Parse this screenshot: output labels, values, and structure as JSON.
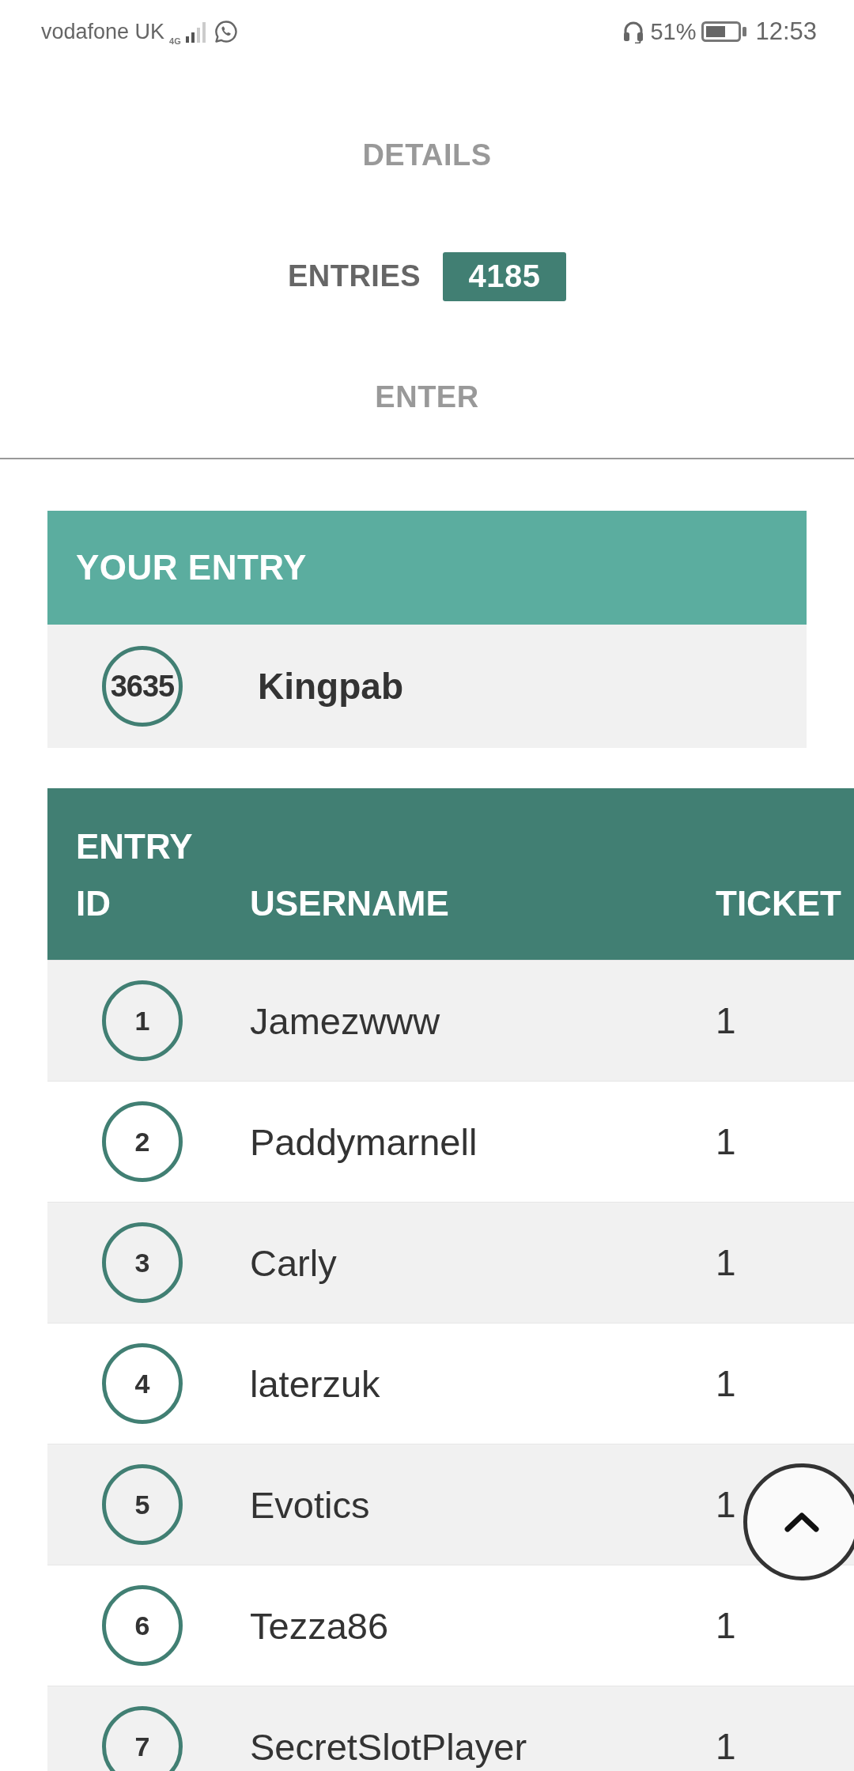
{
  "status_bar": {
    "carrier": "vodafone UK",
    "network": "4G",
    "battery": "51%",
    "time": "12:53"
  },
  "tabs": [
    {
      "label": "DETAILS",
      "selected": false
    },
    {
      "label": "ENTRIES",
      "selected": true,
      "badge": "4185"
    },
    {
      "label": "ENTER",
      "selected": false
    }
  ],
  "your_entry": {
    "title": "YOUR ENTRY",
    "entry_id": "3635",
    "username": "Kingpab"
  },
  "entries_table": {
    "columns": [
      "ENTRY ID",
      "USERNAME",
      "TICKET"
    ],
    "rows": [
      {
        "entry_id": "1",
        "username": "Jamezwww",
        "tickets": "1"
      },
      {
        "entry_id": "2",
        "username": "Paddymarnell",
        "tickets": "1"
      },
      {
        "entry_id": "3",
        "username": "Carly",
        "tickets": "1"
      },
      {
        "entry_id": "4",
        "username": "laterzuk",
        "tickets": "1"
      },
      {
        "entry_id": "5",
        "username": "Evotics",
        "tickets": "1"
      },
      {
        "entry_id": "6",
        "username": "Tezza86",
        "tickets": "1"
      },
      {
        "entry_id": "7",
        "username": "SecretSlotPlayer",
        "tickets": "1"
      }
    ]
  }
}
